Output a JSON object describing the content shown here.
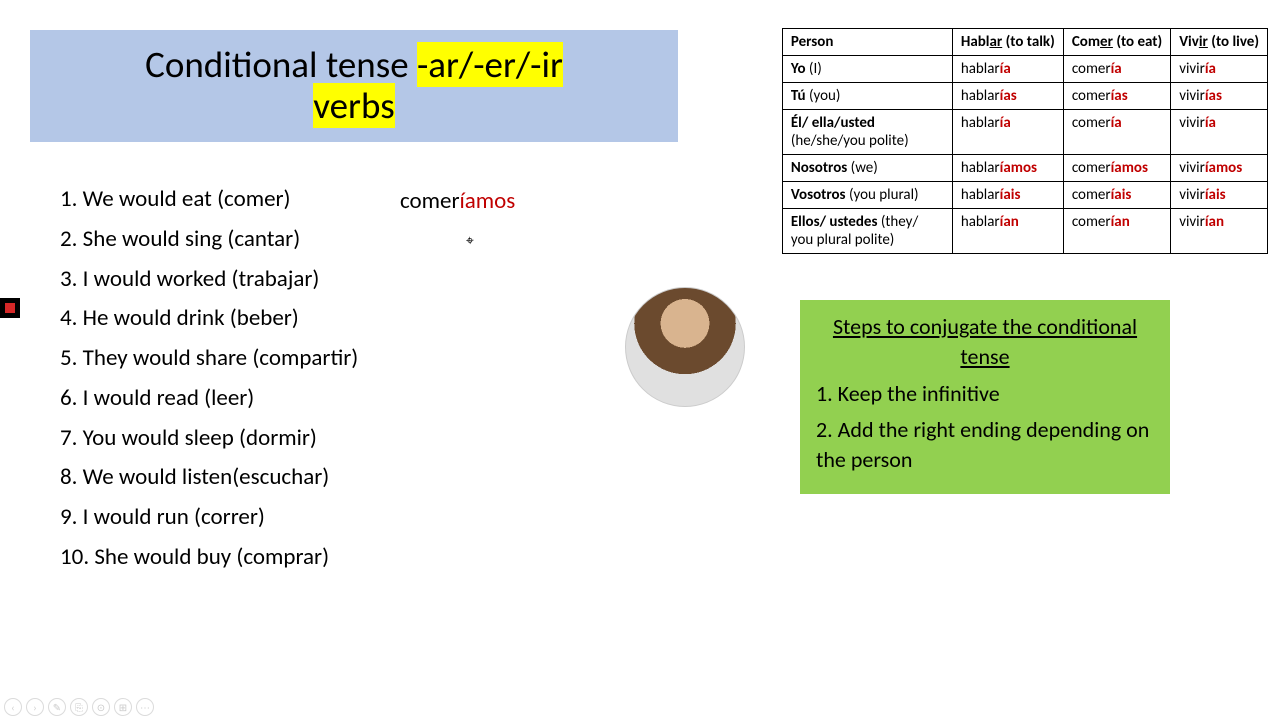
{
  "title": {
    "pre": "Conditional tense ",
    "hl1": "-ar/-er/-ir",
    "mid": " ",
    "hl2": "verbs"
  },
  "exercises": [
    "1. We would eat (comer)",
    "2. She would sing (cantar)",
    "3. I would worked (trabajar)",
    "4. He would drink (beber)",
    "5. They would share (compartir)",
    "6. I would read (leer)",
    "7. You would sleep (dormir)",
    "8. We would listen(escuchar)",
    "9. I would run (correr)",
    "10. She would buy (comprar)"
  ],
  "answer": {
    "stem": "comer",
    "ending": "íamos"
  },
  "table": {
    "headers": {
      "person": "Person",
      "hablar": {
        "stem": "Habl",
        "u": "ar",
        "gloss": " (to talk)"
      },
      "comer": {
        "stem": "Com",
        "u": "er",
        "gloss": " (to eat)"
      },
      "vivir": {
        "stem": "Viv",
        "u": "ir",
        "gloss": " (to live)"
      }
    },
    "rows": [
      {
        "p_bold": "Yo",
        "p_sub": " (I)",
        "h": "hablar",
        "he": "ía",
        "c": "comer",
        "ce": "ía",
        "v": "vivir",
        "ve": "ía"
      },
      {
        "p_bold": "Tú",
        "p_sub": " (you)",
        "h": "hablar",
        "he": "ías",
        "c": "comer",
        "ce": "ías",
        "v": "vivir",
        "ve": "ías"
      },
      {
        "p_bold": "Él/ ella/usted",
        "p_sub": " (he/she/you polite)",
        "h": "hablar",
        "he": "ía",
        "c": "comer",
        "ce": "ía",
        "v": "vivir",
        "ve": "ía",
        "wrap": true
      },
      {
        "p_bold": "Nosotros",
        "p_sub": " (we)",
        "h": "hablar",
        "he": "íamos",
        "c": "comer",
        "ce": "íamos",
        "v": "vivir",
        "ve": "íamos"
      },
      {
        "p_bold": "Vosotros",
        "p_sub": " (you plural)",
        "h": "hablar",
        "he": "íais",
        "c": "comer",
        "ce": "íais",
        "v": "vivir",
        "ve": "íais"
      },
      {
        "p_bold": "Ellos/ ustedes",
        "p_sub": " (they/ you plural polite)",
        "h": "hablar",
        "he": "ían",
        "c": "comer",
        "ce": "ían",
        "v": "vivir",
        "ve": "ían",
        "wrap": true
      }
    ]
  },
  "steps": {
    "title": "Steps to conjugate the conditional tense",
    "s1": "1. Keep the infinitive",
    "s2": "2. Add the right ending depending on the person"
  },
  "toolbar": [
    "‹",
    "›",
    "✎",
    "⎘",
    "⊙",
    "⊞",
    "⋯"
  ]
}
